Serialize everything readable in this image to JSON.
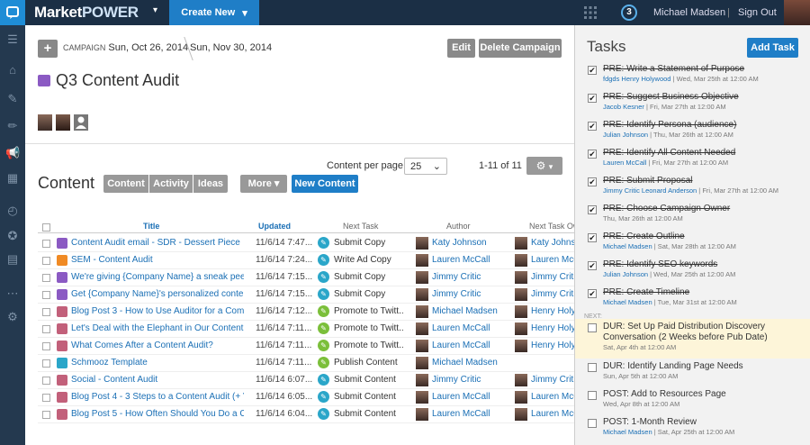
{
  "topbar": {
    "brand_main": "Market",
    "brand_power": "POWER",
    "create_new": "Create New",
    "notif_count": "3",
    "user_name": "Michael Madsen",
    "separator": "|",
    "sign_out": "Sign Out"
  },
  "campaign": {
    "label": "CAMPAIGN",
    "start": "Sun, Oct 26, 2014",
    "end": "Sun, Nov 30, 2014",
    "edit": "Edit",
    "delete": "Delete Campaign",
    "title": "Q3 Content Audit"
  },
  "content": {
    "heading": "Content",
    "tabs": [
      "Content",
      "Activity",
      "Ideas"
    ],
    "more": "More",
    "new_content": "New Content",
    "per_page_label": "Content per page:",
    "per_page_value": "25",
    "pager": "1-11 of 11",
    "columns": {
      "title": "Title",
      "updated": "Updated",
      "next_task": "Next Task",
      "author": "Author",
      "next_task_owner": "Next Task Ow"
    },
    "rows": [
      {
        "title": "Content Audit email - SDR - Dessert Piece",
        "updated": "11/6/14 7:47...",
        "task": "Submit Copy",
        "author": "Katy Johnson",
        "owner": "Katy Johnson",
        "type_color": "#8b5ac3",
        "task_color": "#2aa6c9"
      },
      {
        "title": "SEM - Content Audit",
        "updated": "11/6/14 7:24...",
        "task": "Write Ad Copy",
        "author": "Lauren McCall",
        "owner": "Lauren McCall",
        "type_color": "#f08a24",
        "task_color": "#2aa6c9"
      },
      {
        "title": "We're giving {Company Name} a sneak peek",
        "updated": "11/6/14 7:15...",
        "task": "Submit Copy",
        "author": "Jimmy Critic",
        "owner": "Jimmy Critic",
        "type_color": "#8b5ac3",
        "task_color": "#2aa6c9"
      },
      {
        "title": "Get {Company Name}'s personalized conten...",
        "updated": "11/6/14 7:15...",
        "task": "Submit Copy",
        "author": "Jimmy Critic",
        "owner": "Jimmy Critic",
        "type_color": "#8b5ac3",
        "task_color": "#2aa6c9"
      },
      {
        "title": "Blog Post 3 - How to Use Auditor for a Comp...",
        "updated": "11/6/14 7:12...",
        "task": "Promote to Twitt...",
        "author": "Michael Madsen",
        "owner": "Henry Holywood",
        "type_color": "#c2607a",
        "task_color": "#7bbf3a"
      },
      {
        "title": "Let's Deal with the Elephant in Our Content ...",
        "updated": "11/6/14 7:11...",
        "task": "Promote to Twitt...",
        "author": "Lauren McCall",
        "owner": "Henry Holywood",
        "type_color": "#c2607a",
        "task_color": "#7bbf3a"
      },
      {
        "title": "What Comes After a Content Audit?",
        "updated": "11/6/14 7:11...",
        "task": "Promote to Twitt...",
        "author": "Lauren McCall",
        "owner": "Henry Holywood",
        "type_color": "#c2607a",
        "task_color": "#7bbf3a"
      },
      {
        "title": "Schmooz Template",
        "updated": "11/6/14 7:11...",
        "task": "Publish Content",
        "author": "Michael Madsen",
        "owner": "",
        "type_color": "#2aa6c9",
        "task_color": "#7bbf3a"
      },
      {
        "title": "Social - Content Audit",
        "updated": "11/6/14 6:07...",
        "task": "Submit Content",
        "author": "Jimmy Critic",
        "owner": "Jimmy Critic",
        "type_color": "#c2607a",
        "task_color": "#2aa6c9"
      },
      {
        "title": "Blog Post 4 - 3 Steps to a Content Audit (+ Vi...",
        "updated": "11/6/14 6:05...",
        "task": "Submit Content",
        "author": "Lauren McCall",
        "owner": "Lauren McCall",
        "type_color": "#c2607a",
        "task_color": "#2aa6c9"
      },
      {
        "title": "Blog Post 5 - How Often Should You Do a Co...",
        "updated": "11/6/14 6:04...",
        "task": "Submit Content",
        "author": "Lauren McCall",
        "owner": "Lauren McCall",
        "type_color": "#c2607a",
        "task_color": "#2aa6c9"
      }
    ]
  },
  "tasks": {
    "heading": "Tasks",
    "add_task": "Add Task",
    "next_label": "NEXT:",
    "done": [
      {
        "title": "PRE: Write a Statement of Purpose",
        "who": "fdgds Henry Holywood",
        "when": "Wed, Mar 25th at 12:00 AM"
      },
      {
        "title": "PRE: Suggest Business Objective",
        "who": "Jacob Kesner",
        "when": "Fri, Mar 27th at 12:00 AM"
      },
      {
        "title": "PRE: Identify Persona (audience)",
        "who": "Julian Johnson",
        "when": "Thu, Mar 26th at 12:00 AM"
      },
      {
        "title": "PRE: Identify All Content Needed",
        "who": "Lauren McCall",
        "when": "Fri, Mar 27th at 12:00 AM"
      },
      {
        "title": "PRE: Submit Proposal",
        "who": "Jimmy Critic Leonard Anderson",
        "when": "Fri, Mar 27th at 12:00 AM"
      },
      {
        "title": "PRE: Choose Campaign Owner",
        "who": "",
        "when": "Thu, Mar 26th at 12:00 AM"
      },
      {
        "title": "PRE: Create Outline",
        "who": "Michael Madsen",
        "when": "Sat, Mar 28th at 12:00 AM"
      },
      {
        "title": "PRE: Identify SEO keywords",
        "who": "Julian Johnson",
        "when": "Wed, Mar 25th at 12:00 AM"
      },
      {
        "title": "PRE: Create Timeline",
        "who": "Michael Madsen",
        "when": "Tue, Mar 31st at 12:00 AM"
      }
    ],
    "next": {
      "title": "DUR: Set Up Paid Distribution Discovery Conversation (2 Weeks before Pub Date)",
      "who": "",
      "when": "Sat, Apr 4th at 12:00 AM"
    },
    "upcoming": [
      {
        "title": "DUR: Identify Landing Page Needs",
        "who": "",
        "when": "Sun, Apr 5th at 12:00 AM"
      },
      {
        "title": "POST: Add to Resources Page",
        "who": "",
        "when": "Wed, Apr 8th at 12:00 AM"
      },
      {
        "title": "POST: 1-Month Review",
        "who": "Michael Madsen",
        "when": "Sat, Apr 25th at 12:00 AM"
      }
    ]
  },
  "icons": {
    "logo": "logo-icon",
    "grid": "app-grid-icon",
    "gear": "gear-icon",
    "chevron": "chevron-down-icon"
  },
  "colors": {
    "brand_blue": "#1f7ec7",
    "topbar": "#1b2f45",
    "rail": "#24394f",
    "link": "#1a6fb5"
  }
}
